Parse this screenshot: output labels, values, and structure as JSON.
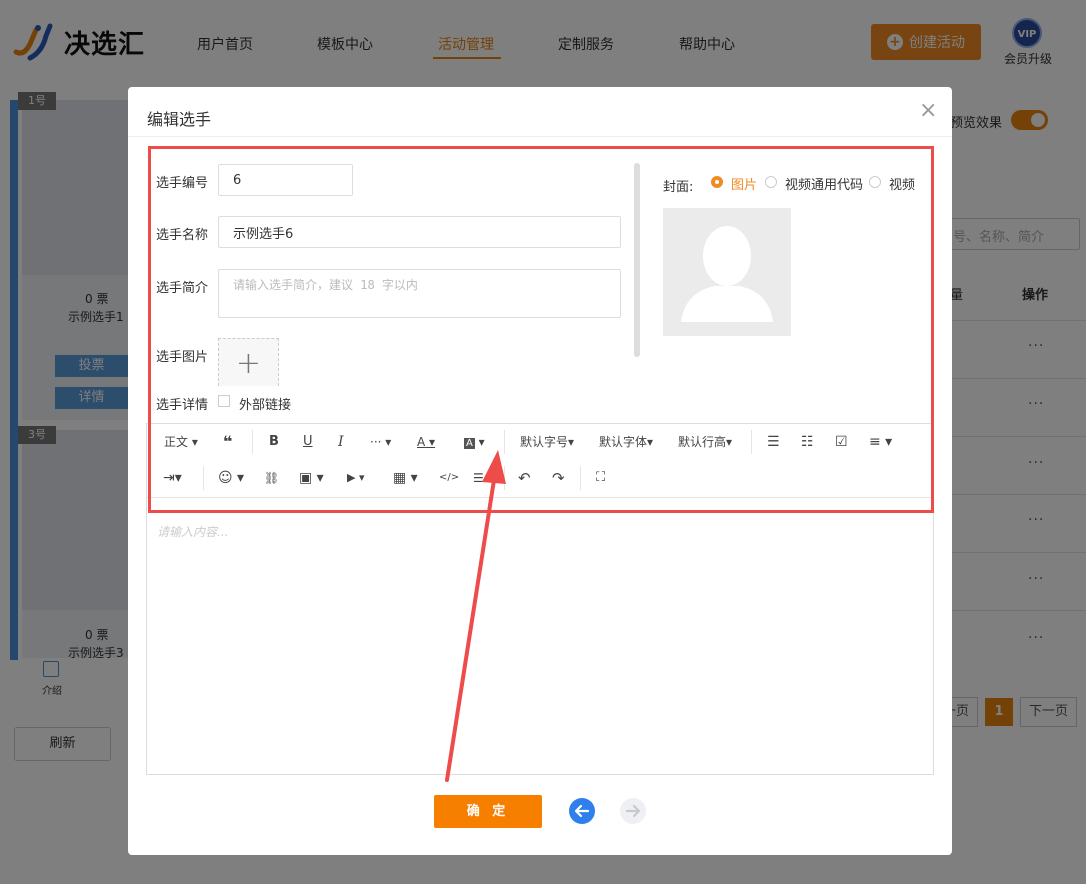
{
  "header": {
    "logo": "决选汇",
    "nav": [
      "用户首页",
      "模板中心",
      "活动管理",
      "定制服务",
      "帮助中心"
    ],
    "active_nav": "活动管理",
    "create_button": "创建活动",
    "vip_badge": "VIP",
    "vip_label": "会员升级"
  },
  "background": {
    "card1": {
      "tag": "1号",
      "votes": "0 票",
      "name": "示例选手1",
      "vote_btn": "投票",
      "detail_btn": "详情"
    },
    "card2": {
      "tag": "3号",
      "votes": "0 票",
      "name": "示例选手3"
    },
    "intro_label": "介绍",
    "refresh": "刷新",
    "preview_label": "预览效果",
    "search_placeholder": "号、名称、简介",
    "col_op": "操作",
    "col_partial": "量",
    "row_dots": [
      "···",
      "···",
      "···",
      "···",
      "···",
      "···"
    ],
    "pagination": {
      "prev": "一页",
      "current": "1",
      "next": "下一页"
    }
  },
  "modal": {
    "title": "编辑选手",
    "close": "×",
    "fields": {
      "number": {
        "label": "选手编号",
        "value": "6"
      },
      "name": {
        "label": "选手名称",
        "value": "示例选手6"
      },
      "intro": {
        "label": "选手简介",
        "placeholder": "请输入选手简介，建议 18 字以内"
      },
      "image": {
        "label": "选手图片",
        "upload": "+"
      },
      "detail": {
        "label": "选手详情",
        "external_link": "外部链接"
      }
    },
    "cover": {
      "label": "封面:",
      "options": [
        "图片",
        "视频通用代码",
        "视频"
      ],
      "selected": "图片"
    },
    "toolbar": {
      "paragraph": "正文",
      "quote": "❝",
      "bold": "B",
      "underline": "U",
      "italic": "I",
      "more": "···",
      "font_color": "A",
      "bg_color": "A",
      "font_size": "默认字号",
      "font_family": "默认字体",
      "line_height": "默认行高",
      "indent": "⇥",
      "emoji": "☺",
      "link": "🔗",
      "image": "▣",
      "video": "▶",
      "table": "▦",
      "code": "</>",
      "divider": "☰",
      "undo": "↶",
      "redo": "↷",
      "fullscreen": "⛶"
    },
    "editor_placeholder": "请输入内容...",
    "confirm": "确 定"
  },
  "colors": {
    "accent": "#f08a24",
    "annotation": "#ee4b4b",
    "nav_prev": "#2f80ed"
  }
}
